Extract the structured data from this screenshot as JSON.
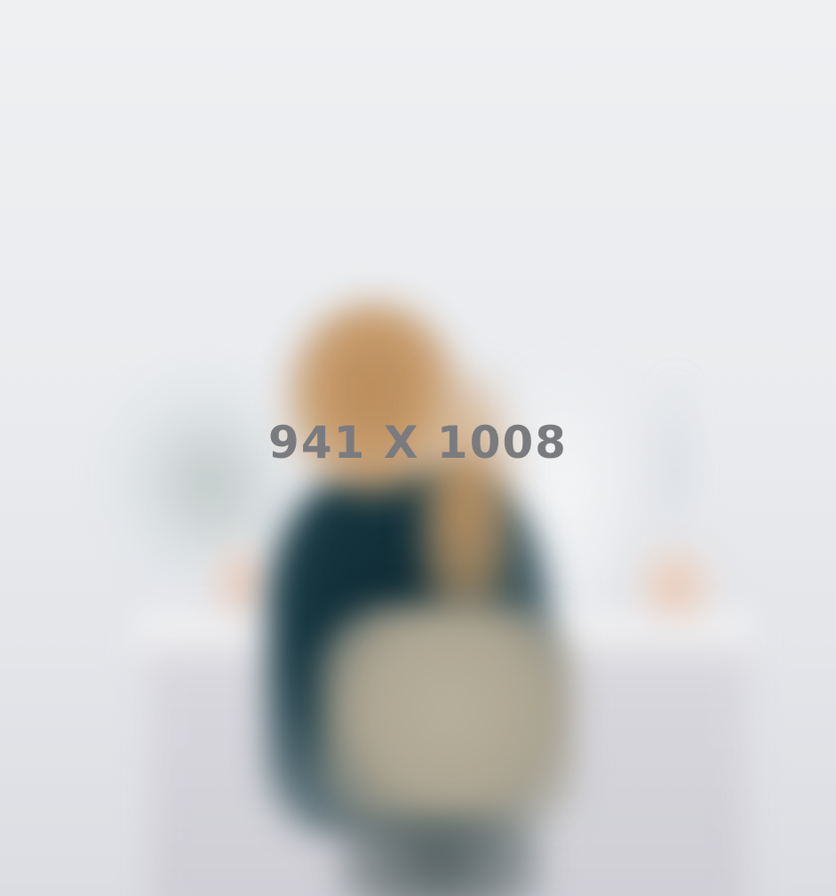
{
  "image": {
    "placeholder_text": "941 X 1008"
  },
  "colors": {
    "wall": "#eceef0",
    "hair": "#c69a6a",
    "sweater": "#163640",
    "chair": "#aea693",
    "desk": "#d7d6dc",
    "label": "#7a7b7e"
  }
}
